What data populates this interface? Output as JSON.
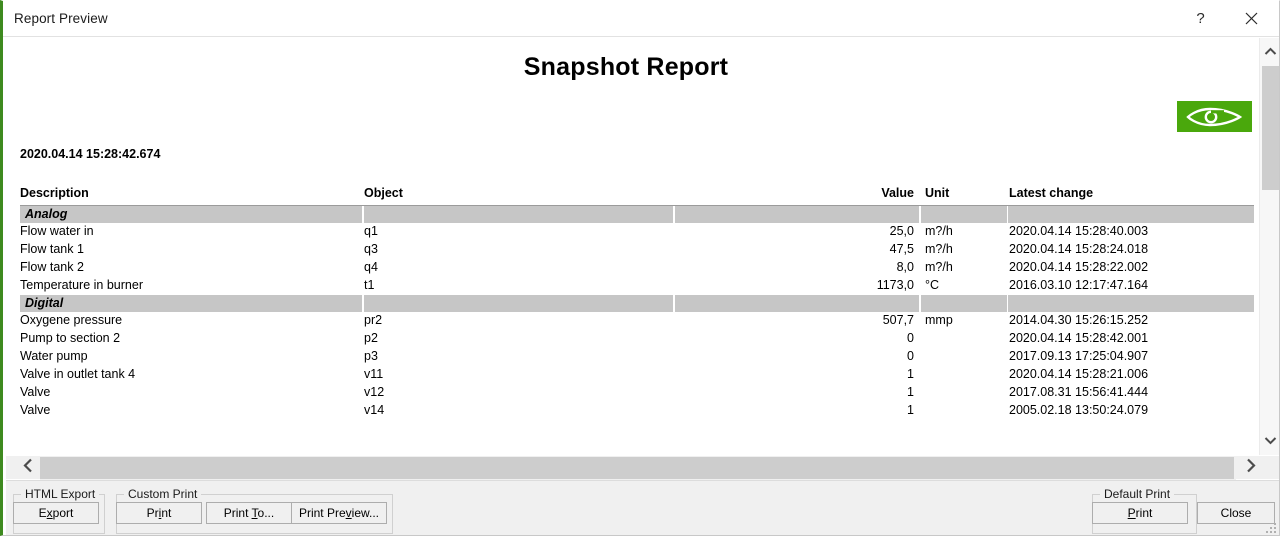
{
  "window": {
    "title": "Report Preview",
    "accent_color": "#3e8a1f",
    "help_icon": "question-mark-icon",
    "close_icon": "close-icon"
  },
  "report": {
    "title": "Snapshot Report",
    "timestamp": "2020.04.14 15:28:42.674",
    "logo": {
      "name": "eye-logo-icon",
      "background_color": "#4aa80c"
    }
  },
  "table": {
    "headers": {
      "description": "Description",
      "object": "Object",
      "value": "Value",
      "unit": "Unit",
      "latest_change": "Latest change"
    },
    "sections": [
      {
        "label": "Analog",
        "rows": [
          {
            "description": "Flow water in",
            "object": "q1",
            "value": "25,0",
            "unit": "m?/h",
            "latest_change": "2020.04.14 15:28:40.003"
          },
          {
            "description": "Flow tank 1",
            "object": "q3",
            "value": "47,5",
            "unit": "m?/h",
            "latest_change": "2020.04.14 15:28:24.018"
          },
          {
            "description": "Flow tank 2",
            "object": "q4",
            "value": "8,0",
            "unit": "m?/h",
            "latest_change": "2020.04.14 15:28:22.002"
          },
          {
            "description": "Temperature in burner",
            "object": "t1",
            "value": "1173,0",
            "unit": "°C",
            "latest_change": "2016.03.10 12:17:47.164"
          }
        ]
      },
      {
        "label": "Digital",
        "rows": [
          {
            "description": "Oxygene pressure",
            "object": "pr2",
            "value": "507,7",
            "unit": "mmp",
            "latest_change": "2014.04.30 15:26:15.252"
          },
          {
            "description": "Pump to section 2",
            "object": "p2",
            "value": "0",
            "unit": "",
            "latest_change": "2020.04.14 15:28:42.001"
          },
          {
            "description": "Water pump",
            "object": "p3",
            "value": "0",
            "unit": "",
            "latest_change": "2017.09.13 17:25:04.907"
          },
          {
            "description": "Valve in outlet tank 4",
            "object": "v11",
            "value": "1",
            "unit": "",
            "latest_change": "2020.04.14 15:28:21.006"
          },
          {
            "description": "Valve",
            "object": "v12",
            "value": "1",
            "unit": "",
            "latest_change": "2017.08.31 15:56:41.444"
          },
          {
            "description": "Valve",
            "object": "v14",
            "value": "1",
            "unit": "",
            "latest_change": "2005.02.18 13:50:24.079"
          }
        ]
      }
    ]
  },
  "scrollbars": {
    "horizontal": {
      "left_arrow": "chevron-left-icon",
      "right_arrow": "chevron-right-icon"
    },
    "vertical": {
      "up_arrow": "chevron-up-icon",
      "down_arrow": "chevron-down-icon"
    }
  },
  "bottom_bar": {
    "groups": {
      "html_export": "HTML Export",
      "custom_print": "Custom Print",
      "default_print": "Default Print"
    },
    "buttons": {
      "export": "Export",
      "print": "Print",
      "print_to": "Print To...",
      "print_preview": "Print Preview...",
      "default_print": "Print",
      "close": "Close"
    }
  }
}
